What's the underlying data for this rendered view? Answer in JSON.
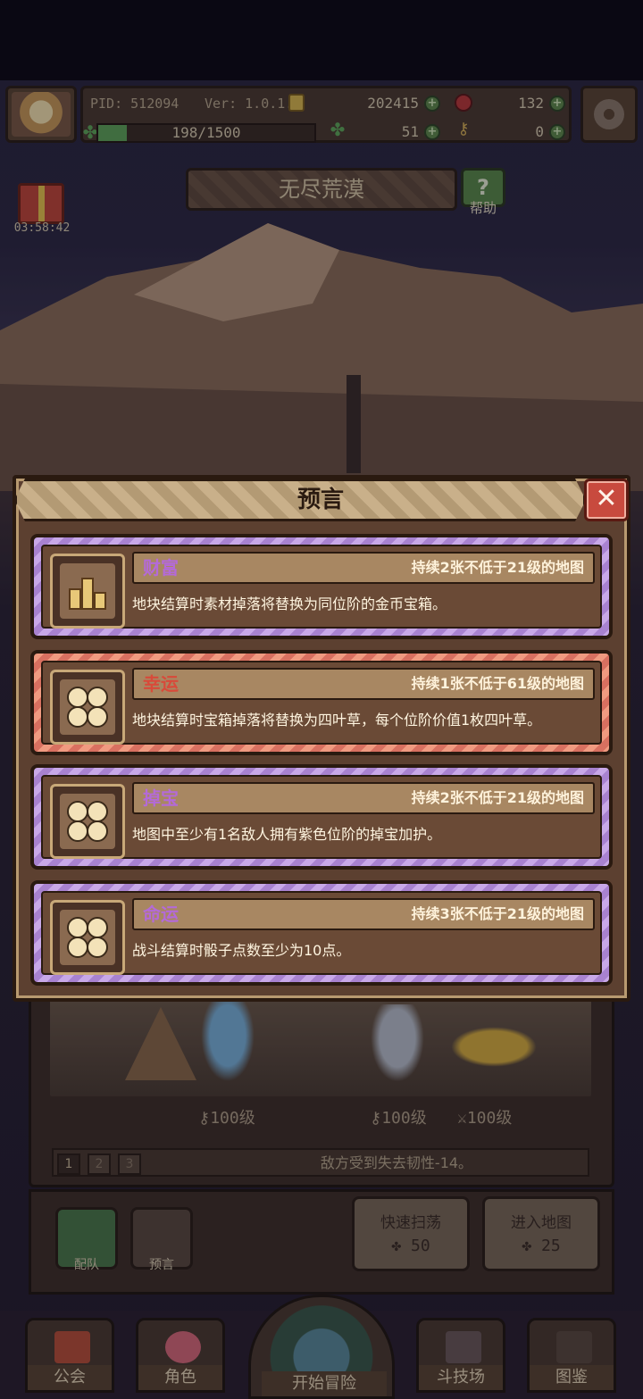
{
  "header": {
    "pid": "PID: 512094",
    "version": "Ver: 1.0.1.2",
    "gold": "202415",
    "apples": "132",
    "exp": "198/1500",
    "exp_fraction": 0.132,
    "clovers": "51",
    "keys": "0"
  },
  "timer": "03:58:42",
  "map_title": "无尽荒漠",
  "help_label": "帮助",
  "battle": {
    "level_1": "100级",
    "level_2": "100级",
    "level_3": "100级",
    "pages": [
      "1",
      "2",
      "3"
    ],
    "status": "敌方受到失去韧性-14。"
  },
  "squad": {
    "team_label": "配队",
    "prophecy_label": "预言"
  },
  "actions": {
    "sweep": {
      "title": "快速扫荡",
      "cost": "50"
    },
    "enter": {
      "title": "进入地图",
      "cost": "25"
    }
  },
  "tabs": {
    "guild": "公会",
    "character": "角色",
    "start": "开始冒险",
    "arena": "斗技场",
    "codex": "图鉴"
  },
  "modal": {
    "title": "预言",
    "close": "✕",
    "cards": [
      {
        "name": "财富",
        "duration": "持续2张不低于21级的地图",
        "desc": "地块结算时素材掉落将替换为同位阶的金币宝箱。",
        "icon": "coins-icon",
        "rarity": "purple"
      },
      {
        "name": "幸运",
        "duration": "持续1张不低于61级的地图",
        "desc": "地块结算时宝箱掉落将替换为四叶草，每个位阶价值1枚四叶草。",
        "icon": "clover-icon",
        "rarity": "red"
      },
      {
        "name": "掉宝",
        "duration": "持续2张不低于21级的地图",
        "desc": "地图中至少有1名敌人拥有紫色位阶的掉宝加护。",
        "icon": "clover-icon",
        "rarity": "purple"
      },
      {
        "name": "命运",
        "duration": "持续3张不低于21级的地图",
        "desc": "战斗结算时骰子点数至少为10点。",
        "icon": "clover-icon",
        "rarity": "purple"
      }
    ]
  },
  "colors": {
    "purple_frame": "#a882d0",
    "red_frame": "#d87060",
    "close_red": "#c84a3e"
  }
}
